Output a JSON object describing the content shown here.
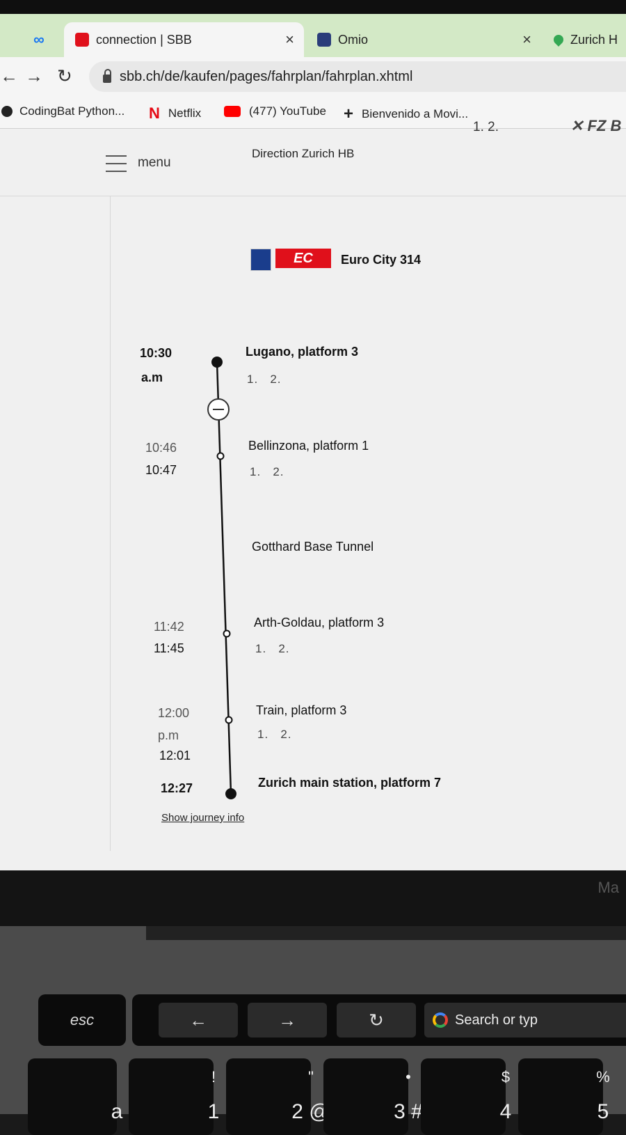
{
  "browser": {
    "tabs": [
      {
        "label": "connection | SBB",
        "active": true
      },
      {
        "label": "Omio",
        "active": false
      },
      {
        "label": "Zurich H",
        "active": false
      }
    ],
    "url": "sbb.ch/de/kaufen/pages/fahrplan/fahrplan.xhtml",
    "bookmarks": [
      "CodingBat Python...",
      "Netflix",
      "(477) YouTube",
      "Bienvenido a Movi..."
    ]
  },
  "page": {
    "menu_label": "menu",
    "train": {
      "badge": "EC",
      "name": "Euro City 314",
      "direction": "Direction Zurich HB",
      "occupancy_right": "1. 2.",
      "extra": "FZ B"
    },
    "stops": [
      {
        "time1": "10:30",
        "time2": "a.m",
        "name": "Lugano, platform 3",
        "occupancy": "1.   2."
      },
      {
        "time1": "10:46",
        "time2": "10:47",
        "name": "Bellinzona, platform 1",
        "occupancy": "1.   2."
      },
      {
        "time1": "",
        "time2": "",
        "name": "Gotthard Base Tunnel",
        "occupancy": ""
      },
      {
        "time1": "11:42",
        "time2": "11:45",
        "name": "Arth-Goldau, platform 3",
        "occupancy": "1.   2."
      },
      {
        "time1": "12:00",
        "time2": "p.m",
        "time3": "12:01",
        "name": "Train, platform 3",
        "occupancy": "1.   2."
      },
      {
        "time1": "12:27",
        "name": "Zurich main station, platform 7"
      }
    ],
    "show_journey_info": "Show journey info"
  },
  "laptop": {
    "model_label": "Ma",
    "esc": "esc",
    "search_pill": "Search or typ",
    "keys": [
      {
        "top": "",
        "bottom": "a"
      },
      {
        "top": "!",
        "bottom": "1"
      },
      {
        "top": "\"",
        "bottom": "2 @"
      },
      {
        "top": "•",
        "bottom": "3 #"
      },
      {
        "top": "$",
        "bottom": "4"
      },
      {
        "top": "%",
        "bottom": "5"
      }
    ]
  },
  "colors": {
    "tabbar": "#d3e9c6",
    "sbb_red": "#e0101b",
    "sbb_blue": "#1a3d8c"
  }
}
